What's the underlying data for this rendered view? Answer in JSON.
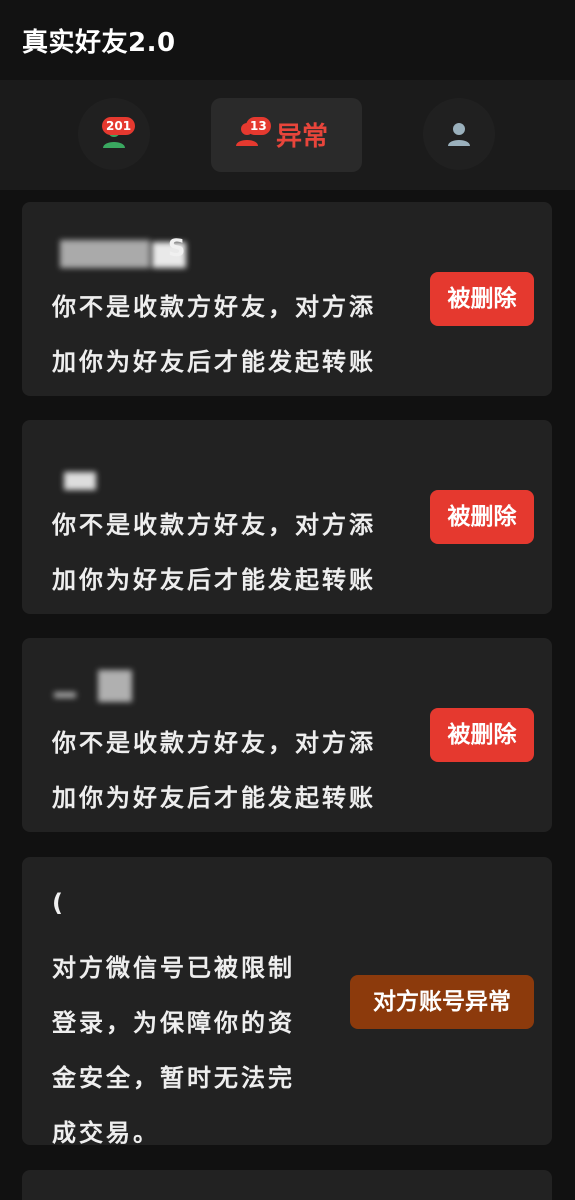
{
  "app": {
    "title": "真实好友2.0"
  },
  "tabs": {
    "all": {
      "badge": "201",
      "icon": "person-icon"
    },
    "abnormal": {
      "badge": "13",
      "label": "异常",
      "icon": "person-icon"
    },
    "profile": {
      "icon": "person-icon"
    }
  },
  "colors": {
    "deleted": "#e5392f",
    "account_abnormal": "#8c3a0c",
    "active_tab_text": "#e8453b",
    "normal_icon": "#3aa860",
    "profile_icon": "#9ab0bc"
  },
  "cards": [
    {
      "name_tail": "S",
      "message_line1": "你不是收款方好友，对方添",
      "message_line2": "加你为好友后才能发起转账",
      "status": "被删除"
    },
    {
      "message_line1": "你不是收款方好友，对方添",
      "message_line2": "加你为好友后才能发起转账",
      "status": "被删除"
    },
    {
      "message_line1": "你不是收款方好友，对方添",
      "message_line2": "加你为好友后才能发起转账",
      "status": "被删除"
    },
    {
      "name_tail": "(",
      "message_line1": "对方微信号已被限制",
      "message_line2": "登录，为保障你的资",
      "message_line3": "金安全，暂时无法完",
      "message_line4": "成交易。",
      "status": "对方账号异常"
    }
  ]
}
